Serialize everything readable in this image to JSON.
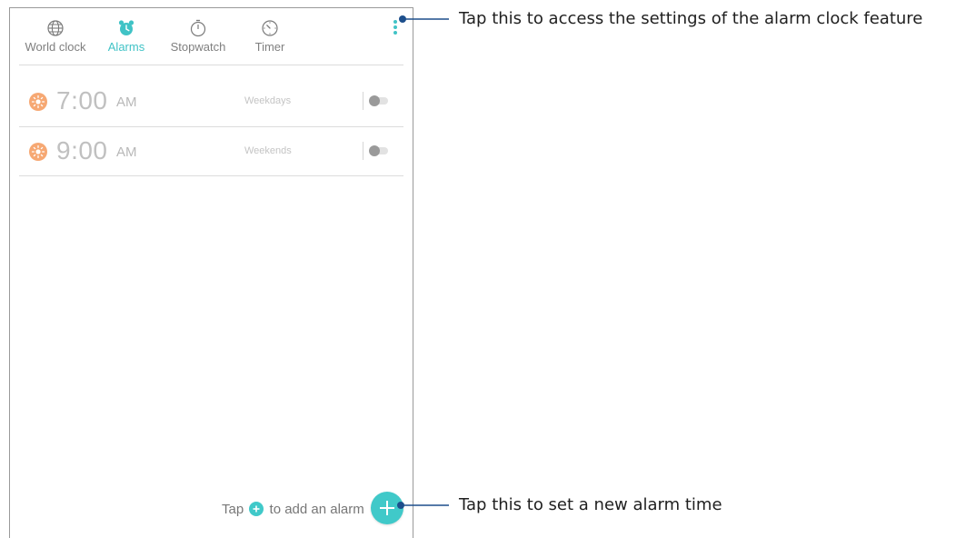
{
  "colors": {
    "accent": "#40c3c6",
    "sun": "#f6a873",
    "leader": "#1d4f8c"
  },
  "tabs": [
    {
      "label": "World clock",
      "icon": "globe-icon",
      "active": false
    },
    {
      "label": "Alarms",
      "icon": "alarm-clock-icon",
      "active": true
    },
    {
      "label": "Stopwatch",
      "icon": "stopwatch-icon",
      "active": false
    },
    {
      "label": "Timer",
      "icon": "timer-icon",
      "active": false
    }
  ],
  "menu": {
    "icon": "more-vert-icon"
  },
  "alarms": [
    {
      "time": "7:00",
      "ampm": "AM",
      "repeat": "Weekdays",
      "enabled": false,
      "icon": "sun-icon"
    },
    {
      "time": "9:00",
      "ampm": "AM",
      "repeat": "Weekends",
      "enabled": false,
      "icon": "sun-icon"
    }
  ],
  "hint": {
    "prefix": "Tap",
    "suffix": "to add an alarm",
    "icon": "add-circle-icon"
  },
  "fab": {
    "icon": "plus-icon"
  },
  "callouts": {
    "settings": "Tap this to access the settings of the alarm clock feature",
    "add_alarm": "Tap this to set a new alarm time"
  }
}
